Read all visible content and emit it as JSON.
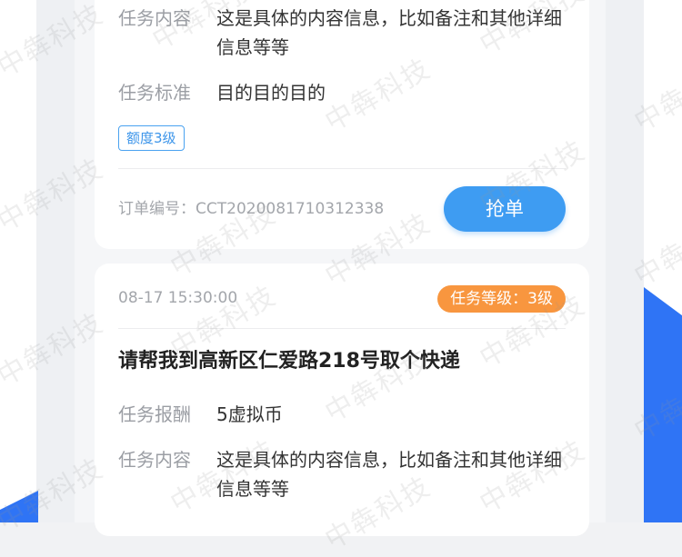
{
  "cards": [
    {
      "content_label": "任务内容",
      "content_value": "这是具体的内容信息，比如备注和其他详细信息等等",
      "standard_label": "任务标准",
      "standard_value": "目的目的目的",
      "quota_badge": "额度3级",
      "order_no": "订单编号：CCT2020081710312338",
      "grab_label": "抢单"
    },
    {
      "time": "08-17 15:30:00",
      "level_badge": "任务等级：3级",
      "title": "请帮我到高新区仁爱路218号取个快递",
      "reward_label": "任务报酬",
      "reward_value": "5虚拟币",
      "content_label": "任务内容",
      "content_value": "这是具体的内容信息，比如备注和其他详细信息等等"
    }
  ],
  "watermark": "中犇科技",
  "colors": {
    "primary_blue": "#3e9cf2",
    "accent_orange": "#f8963f",
    "side_blue": "#2f74f5"
  }
}
